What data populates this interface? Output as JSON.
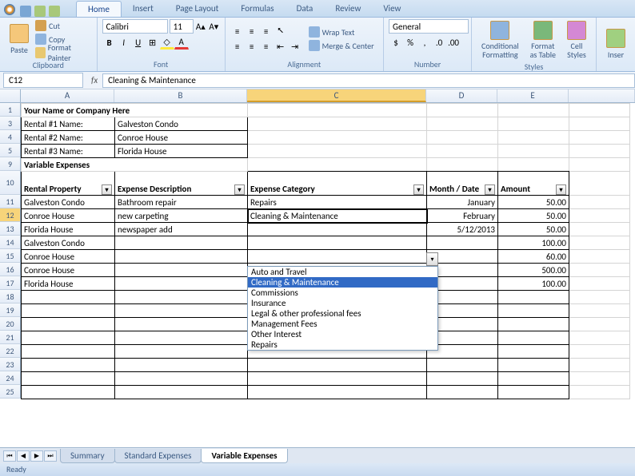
{
  "tabs": [
    "Home",
    "Insert",
    "Page Layout",
    "Formulas",
    "Data",
    "Review",
    "View"
  ],
  "active_tab": 0,
  "clipboard": {
    "paste": "Paste",
    "cut": "Cut",
    "copy": "Copy",
    "painter": "Format Painter",
    "label": "Clipboard"
  },
  "font": {
    "name": "Calibri",
    "size": "11",
    "label": "Font"
  },
  "alignment": {
    "wrap": "Wrap Text",
    "merge": "Merge & Center",
    "label": "Alignment"
  },
  "number": {
    "format": "General",
    "label": "Number"
  },
  "styles": {
    "cond": "Conditional\nFormatting",
    "fmt": "Format\nas Table",
    "cell": "Cell\nStyles",
    "label": "Styles"
  },
  "cells_grp": {
    "ins": "Inser",
    "label": ""
  },
  "namebox": "C12",
  "formula": "Cleaning & Maintenance",
  "columns": [
    "A",
    "B",
    "C",
    "D",
    "E"
  ],
  "title": "Your Name or Company Here",
  "rentals": [
    {
      "label": "Rental #1 Name:",
      "value": "Galveston Condo"
    },
    {
      "label": "Rental #2 Name:",
      "value": "Conroe House"
    },
    {
      "label": "Rental #3 Name:",
      "value": "Florida House"
    }
  ],
  "section": "Variable Expenses",
  "headers": {
    "a": "Rental Property",
    "b": "Expense Description",
    "c": "Expense Category",
    "d": "Month / Date",
    "e": "Amount"
  },
  "rows": [
    {
      "a": "Galveston Condo",
      "b": "Bathroom repair",
      "c": "Repairs",
      "d": "January",
      "e": "50.00"
    },
    {
      "a": "Conroe House",
      "b": "new carpeting",
      "c": "Cleaning & Maintenance",
      "d": "February",
      "e": "50.00"
    },
    {
      "a": "Florida House",
      "b": "newspaper add",
      "c": "",
      "d": "5/12/2013",
      "e": "50.00"
    },
    {
      "a": "Galveston Condo",
      "b": "",
      "c": "",
      "d": "",
      "e": "100.00"
    },
    {
      "a": "Conroe House",
      "b": "",
      "c": "",
      "d": "",
      "e": "60.00"
    },
    {
      "a": "Conroe House",
      "b": "",
      "c": "",
      "d": "",
      "e": "500.00"
    },
    {
      "a": "Florida House",
      "b": "",
      "c": "",
      "d": "",
      "e": "100.00"
    }
  ],
  "dropdown": [
    "Auto and Travel",
    "Cleaning & Maintenance",
    "Commissions",
    "Insurance",
    "Legal & other professional fees",
    "Management Fees",
    "Other Interest",
    "Repairs"
  ],
  "dropdown_hl": 1,
  "sheet_tabs": [
    "Summary",
    "Standard Expenses",
    "Variable Expenses"
  ],
  "active_sheet": 2,
  "status": "Ready"
}
